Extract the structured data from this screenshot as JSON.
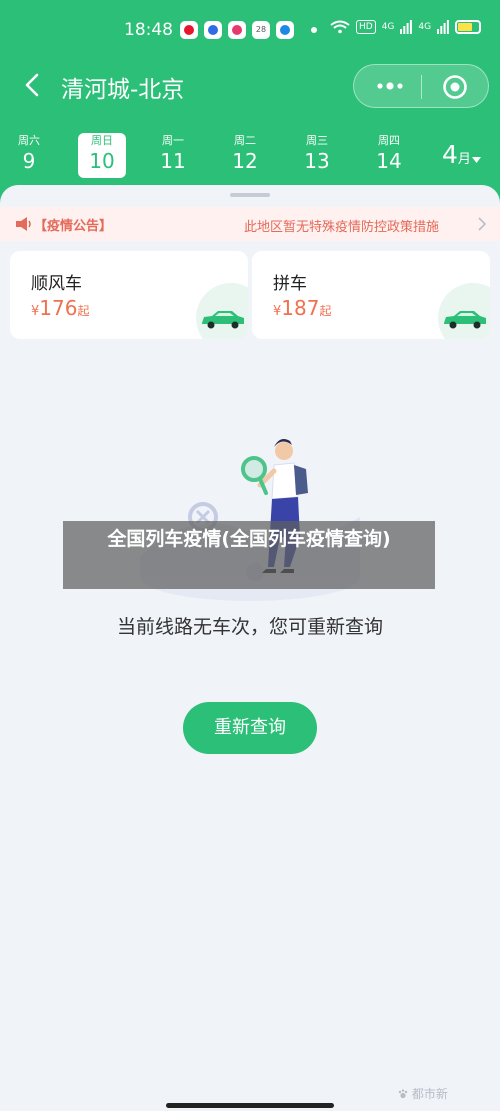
{
  "status_bar": {
    "time": "18:48",
    "network_badge": "HD",
    "signal_1": "4G",
    "signal_2": "4G",
    "app_icons": [
      "weibo-icon",
      "baidu-icon",
      "app-icon",
      "calendar-icon",
      "browser-icon"
    ],
    "calendar_day": "28"
  },
  "nav": {
    "title": "清河城-北京",
    "back_icon": "back-arrow-icon",
    "menu_icon": "more-dots-icon",
    "close_icon": "target-close-icon"
  },
  "dates": [
    {
      "weekday": "周六",
      "day": "9",
      "active": false
    },
    {
      "weekday": "周日",
      "day": "10",
      "active": true
    },
    {
      "weekday": "周一",
      "day": "11",
      "active": false
    },
    {
      "weekday": "周二",
      "day": "12",
      "active": false
    },
    {
      "weekday": "周三",
      "day": "13",
      "active": false
    },
    {
      "weekday": "周四",
      "day": "14",
      "active": false
    }
  ],
  "month": {
    "value": "4",
    "unit": "月"
  },
  "notice": {
    "title": "【疫情公告】",
    "text": "此地区暂无特殊疫情防控政策措施"
  },
  "cards": [
    {
      "title": "顺风车",
      "currency": "¥",
      "price": "176",
      "suffix": "起"
    },
    {
      "title": "拼车",
      "currency": "¥",
      "price": "187",
      "suffix": "起"
    }
  ],
  "empty_state": {
    "message": "当前线路无车次，您可重新查询",
    "button": "重新查询"
  },
  "overlay_caption": "全国列车疫情(全国列车疫情查询)",
  "watermark": "都市新",
  "colors": {
    "brand_green": "#2cbf78",
    "notice_red": "#e46a5a",
    "price_orange": "#f0714f"
  }
}
